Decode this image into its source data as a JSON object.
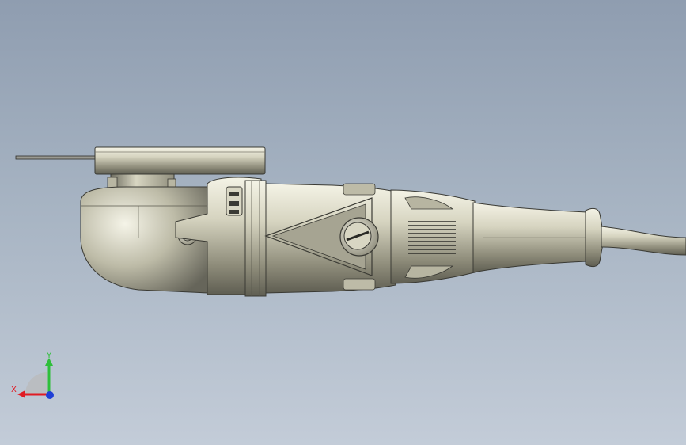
{
  "viewport": {
    "background_top": "#8f9db0",
    "background_bottom": "#c3ccd8"
  },
  "model": {
    "body_color": "#c9c7b4",
    "edge_color": "#3a3a34"
  },
  "triad": {
    "x_label": "X",
    "y_label": "Y",
    "x_color": "#e01b24",
    "y_color": "#2fbf3a",
    "z_color": "#1f3fd6"
  }
}
